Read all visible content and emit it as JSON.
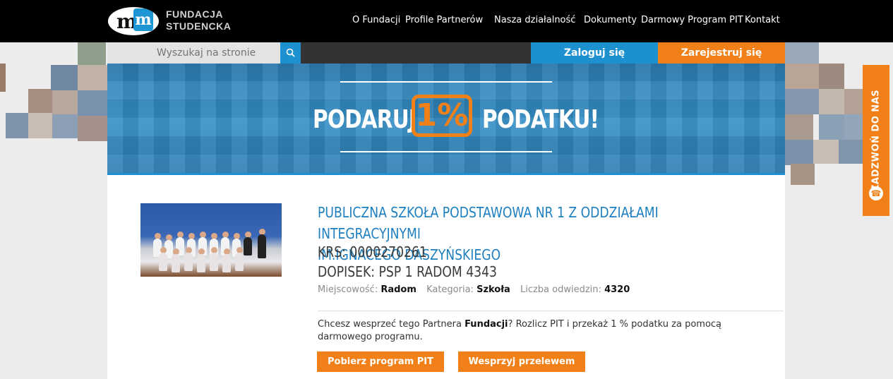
{
  "brand": {
    "line1": "FUNDACJA",
    "line2": "STUDENCKA",
    "logo_letters": "m",
    "logo_letters_accent": "m"
  },
  "nav": [
    "O Fundacji",
    "Profile Partnerów",
    "Nasza działalność",
    "Dokumenty",
    "Darmowy Program PIT",
    "Kontakt"
  ],
  "search": {
    "placeholder": "Wyszukaj na stronie"
  },
  "auth": {
    "login": "Zaloguj się",
    "register": "Zarejestruj się"
  },
  "banner": {
    "left": "PODARUJ",
    "percent": "1%",
    "right": "PODATKU!"
  },
  "side_tab": {
    "label": "ZADZWOŃ DO NAS",
    "icon": "phone-icon"
  },
  "partner": {
    "title_line1": "PUBLICZNA SZKOŁA PODSTAWOWA NR 1 Z ODDZIAŁAMI INTEGRACYJNYMI",
    "title_line2": "IM.IGNACEGO DASZYŃSKIEGO",
    "krs": "KRS: 0000270261",
    "dopisek": "DOPISEK: PSP 1 RADOM 4343",
    "city_label": "Miejscowość:",
    "city": "Radom",
    "category_label": "Kategoria:",
    "category": "Szkoła",
    "visits_label": "Liczba odwiedzin:",
    "visits": "4320"
  },
  "support": {
    "text_before": "Chcesz wesprzeć tego Partnera ",
    "text_bold": "Fundacji",
    "text_after": "? Rozlicz PIT i przekaż 1 % podatku za pomocą darmowego programu."
  },
  "buttons": {
    "download_pit": "Pobierz program PIT",
    "transfer": "Wesprzyj przelewem"
  },
  "colors": {
    "accent_blue": "#1d91cf",
    "accent_orange": "#f08017"
  }
}
